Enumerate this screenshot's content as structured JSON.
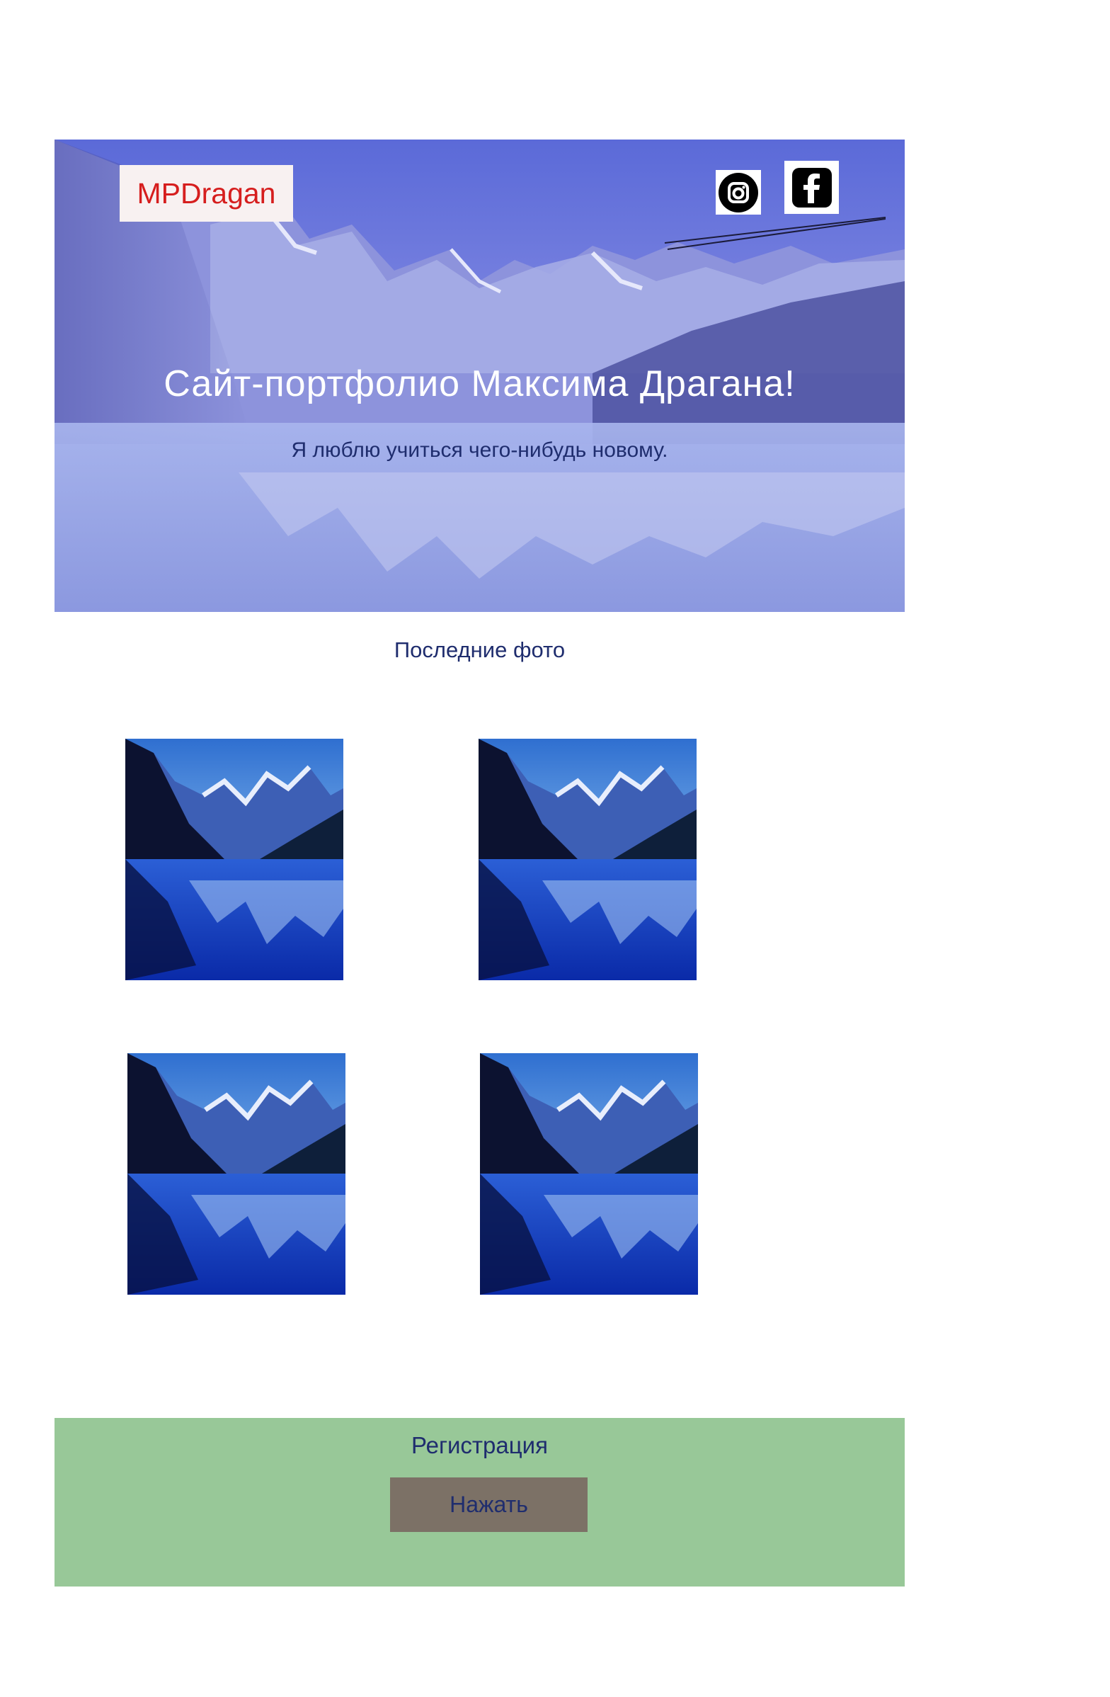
{
  "header": {
    "logo_text": "MPDragan",
    "title": "Сайт-портфолио Максима Драгана!",
    "subtitle": "Я люблю учиться чего-нибудь новому.",
    "social": [
      {
        "icon": "instagram-icon"
      },
      {
        "icon": "facebook-icon"
      }
    ]
  },
  "gallery": {
    "title": "Последние фото",
    "photos": [
      {
        "image": "mountain-lake"
      },
      {
        "image": "mountain-lake"
      },
      {
        "image": "mountain-lake"
      },
      {
        "image": "mountain-lake"
      }
    ]
  },
  "registration": {
    "title": "Регистрация",
    "button_label": "Нажать"
  },
  "colors": {
    "logo_text": "#d61e1e",
    "dark_text": "#1f2d6e",
    "registration_bg": "#98c898",
    "button_bg": "#7c7166"
  }
}
